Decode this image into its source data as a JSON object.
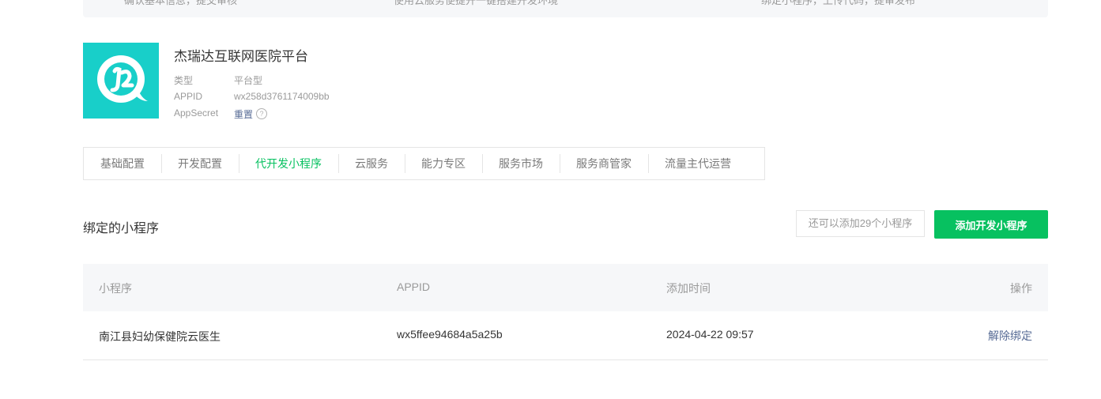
{
  "top_strip": {
    "items": [
      "确认基本信息，提交审核",
      "使用云服务便捷开一键搭建开发环境",
      "绑定小程序，上传代码，提审发布"
    ]
  },
  "app": {
    "name": "杰瑞达互联网医院平台",
    "type_label": "类型",
    "type_value": "平台型",
    "appid_label": "APPID",
    "appid_value": "wx258d3761174009bb",
    "secret_label": "AppSecret",
    "secret_action": "重置",
    "help_glyph": "?"
  },
  "tabs": [
    {
      "label": "基础配置"
    },
    {
      "label": "开发配置"
    },
    {
      "label": "代开发小程序",
      "active": true
    },
    {
      "label": "云服务"
    },
    {
      "label": "能力专区"
    },
    {
      "label": "服务市场"
    },
    {
      "label": "服务商管家"
    },
    {
      "label": "流量主代运营"
    }
  ],
  "bound": {
    "title": "绑定的小程序",
    "quota_text": "还可以添加29个小程序",
    "add_button": "添加开发小程序"
  },
  "table": {
    "headers": [
      "小程序",
      "APPID",
      "添加时间",
      "操作"
    ],
    "rows": [
      {
        "name": "南江县妇幼保健院云医生",
        "appid": "wx5ffee94684a5a25b",
        "added": "2024-04-22 09:57",
        "action": "解除绑定"
      }
    ]
  },
  "colors": {
    "brand_green": "#07c160",
    "logo_teal": "#18cfc9",
    "link_blue": "#576b95"
  }
}
